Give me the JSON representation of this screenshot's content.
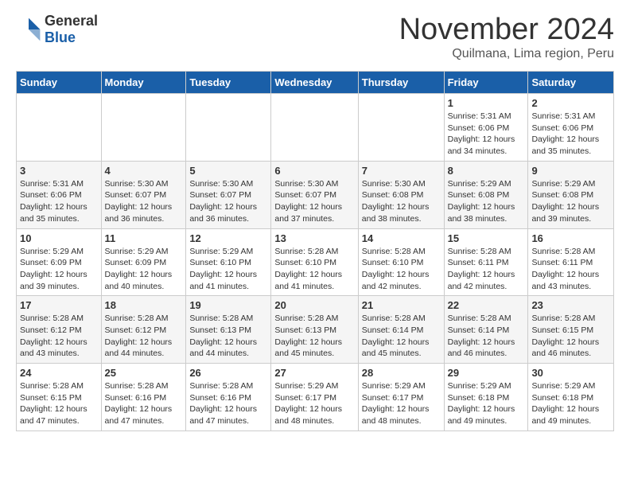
{
  "header": {
    "logo_general": "General",
    "logo_blue": "Blue",
    "month_title": "November 2024",
    "subtitle": "Quilmana, Lima region, Peru"
  },
  "weekdays": [
    "Sunday",
    "Monday",
    "Tuesday",
    "Wednesday",
    "Thursday",
    "Friday",
    "Saturday"
  ],
  "weeks": [
    [
      {
        "day": "",
        "info": ""
      },
      {
        "day": "",
        "info": ""
      },
      {
        "day": "",
        "info": ""
      },
      {
        "day": "",
        "info": ""
      },
      {
        "day": "",
        "info": ""
      },
      {
        "day": "1",
        "info": "Sunrise: 5:31 AM\nSunset: 6:06 PM\nDaylight: 12 hours and 34 minutes."
      },
      {
        "day": "2",
        "info": "Sunrise: 5:31 AM\nSunset: 6:06 PM\nDaylight: 12 hours and 35 minutes."
      }
    ],
    [
      {
        "day": "3",
        "info": "Sunrise: 5:31 AM\nSunset: 6:06 PM\nDaylight: 12 hours and 35 minutes."
      },
      {
        "day": "4",
        "info": "Sunrise: 5:30 AM\nSunset: 6:07 PM\nDaylight: 12 hours and 36 minutes."
      },
      {
        "day": "5",
        "info": "Sunrise: 5:30 AM\nSunset: 6:07 PM\nDaylight: 12 hours and 36 minutes."
      },
      {
        "day": "6",
        "info": "Sunrise: 5:30 AM\nSunset: 6:07 PM\nDaylight: 12 hours and 37 minutes."
      },
      {
        "day": "7",
        "info": "Sunrise: 5:30 AM\nSunset: 6:08 PM\nDaylight: 12 hours and 38 minutes."
      },
      {
        "day": "8",
        "info": "Sunrise: 5:29 AM\nSunset: 6:08 PM\nDaylight: 12 hours and 38 minutes."
      },
      {
        "day": "9",
        "info": "Sunrise: 5:29 AM\nSunset: 6:08 PM\nDaylight: 12 hours and 39 minutes."
      }
    ],
    [
      {
        "day": "10",
        "info": "Sunrise: 5:29 AM\nSunset: 6:09 PM\nDaylight: 12 hours and 39 minutes."
      },
      {
        "day": "11",
        "info": "Sunrise: 5:29 AM\nSunset: 6:09 PM\nDaylight: 12 hours and 40 minutes."
      },
      {
        "day": "12",
        "info": "Sunrise: 5:29 AM\nSunset: 6:10 PM\nDaylight: 12 hours and 41 minutes."
      },
      {
        "day": "13",
        "info": "Sunrise: 5:28 AM\nSunset: 6:10 PM\nDaylight: 12 hours and 41 minutes."
      },
      {
        "day": "14",
        "info": "Sunrise: 5:28 AM\nSunset: 6:10 PM\nDaylight: 12 hours and 42 minutes."
      },
      {
        "day": "15",
        "info": "Sunrise: 5:28 AM\nSunset: 6:11 PM\nDaylight: 12 hours and 42 minutes."
      },
      {
        "day": "16",
        "info": "Sunrise: 5:28 AM\nSunset: 6:11 PM\nDaylight: 12 hours and 43 minutes."
      }
    ],
    [
      {
        "day": "17",
        "info": "Sunrise: 5:28 AM\nSunset: 6:12 PM\nDaylight: 12 hours and 43 minutes."
      },
      {
        "day": "18",
        "info": "Sunrise: 5:28 AM\nSunset: 6:12 PM\nDaylight: 12 hours and 44 minutes."
      },
      {
        "day": "19",
        "info": "Sunrise: 5:28 AM\nSunset: 6:13 PM\nDaylight: 12 hours and 44 minutes."
      },
      {
        "day": "20",
        "info": "Sunrise: 5:28 AM\nSunset: 6:13 PM\nDaylight: 12 hours and 45 minutes."
      },
      {
        "day": "21",
        "info": "Sunrise: 5:28 AM\nSunset: 6:14 PM\nDaylight: 12 hours and 45 minutes."
      },
      {
        "day": "22",
        "info": "Sunrise: 5:28 AM\nSunset: 6:14 PM\nDaylight: 12 hours and 46 minutes."
      },
      {
        "day": "23",
        "info": "Sunrise: 5:28 AM\nSunset: 6:15 PM\nDaylight: 12 hours and 46 minutes."
      }
    ],
    [
      {
        "day": "24",
        "info": "Sunrise: 5:28 AM\nSunset: 6:15 PM\nDaylight: 12 hours and 47 minutes."
      },
      {
        "day": "25",
        "info": "Sunrise: 5:28 AM\nSunset: 6:16 PM\nDaylight: 12 hours and 47 minutes."
      },
      {
        "day": "26",
        "info": "Sunrise: 5:28 AM\nSunset: 6:16 PM\nDaylight: 12 hours and 47 minutes."
      },
      {
        "day": "27",
        "info": "Sunrise: 5:29 AM\nSunset: 6:17 PM\nDaylight: 12 hours and 48 minutes."
      },
      {
        "day": "28",
        "info": "Sunrise: 5:29 AM\nSunset: 6:17 PM\nDaylight: 12 hours and 48 minutes."
      },
      {
        "day": "29",
        "info": "Sunrise: 5:29 AM\nSunset: 6:18 PM\nDaylight: 12 hours and 49 minutes."
      },
      {
        "day": "30",
        "info": "Sunrise: 5:29 AM\nSunset: 6:18 PM\nDaylight: 12 hours and 49 minutes."
      }
    ]
  ]
}
